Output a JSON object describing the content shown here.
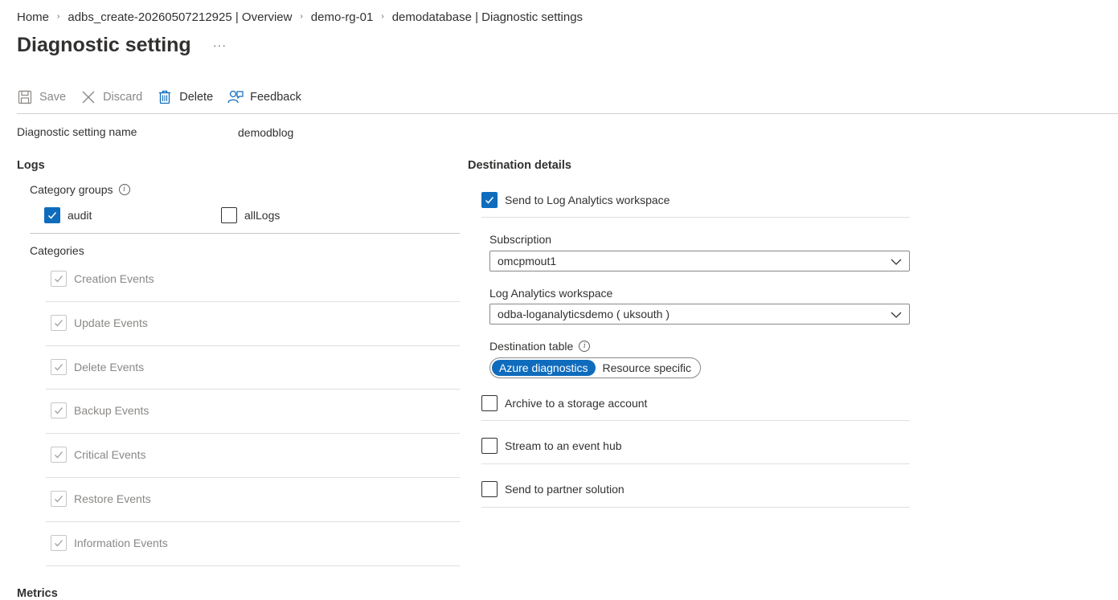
{
  "breadcrumb": {
    "items": [
      "Home",
      "adbs_create-20260507212925 | Overview",
      "demo-rg-01",
      "demodatabase | Diagnostic settings"
    ],
    "separator": "›"
  },
  "page": {
    "title": "Diagnostic setting",
    "more": "···"
  },
  "toolbar": {
    "save": "Save",
    "discard": "Discard",
    "delete": "Delete",
    "feedback": "Feedback"
  },
  "setting": {
    "name_label": "Diagnostic setting name",
    "name_value": "demodblog"
  },
  "logs": {
    "heading": "Logs",
    "category_groups_label": "Category groups",
    "info": "i",
    "groups": [
      {
        "label": "audit",
        "checked": true
      },
      {
        "label": "allLogs",
        "checked": false
      }
    ],
    "categories_label": "Categories",
    "categories": [
      {
        "label": "Creation Events",
        "checked": true,
        "disabled": true
      },
      {
        "label": "Update Events",
        "checked": true,
        "disabled": true
      },
      {
        "label": "Delete Events",
        "checked": true,
        "disabled": true
      },
      {
        "label": "Backup Events",
        "checked": true,
        "disabled": true
      },
      {
        "label": "Critical Events",
        "checked": true,
        "disabled": true
      },
      {
        "label": "Restore Events",
        "checked": true,
        "disabled": true
      },
      {
        "label": "Information Events",
        "checked": true,
        "disabled": true
      }
    ]
  },
  "metrics": {
    "heading": "Metrics"
  },
  "destination": {
    "heading": "Destination details",
    "log_analytics": {
      "label": "Send to Log Analytics workspace",
      "checked": true
    },
    "subscription_label": "Subscription",
    "subscription_value": "omcpmout1",
    "workspace_label": "Log Analytics workspace",
    "workspace_value": "odba-loganalyticsdemo ( uksouth )",
    "table_label": "Destination table",
    "info": "i",
    "table_options": [
      "Azure diagnostics",
      "Resource specific"
    ],
    "table_selected": "Azure diagnostics",
    "archive": {
      "label": "Archive to a storage account",
      "checked": false
    },
    "event_hub": {
      "label": "Stream to an event hub",
      "checked": false
    },
    "partner": {
      "label": "Send to partner solution",
      "checked": false
    }
  },
  "colors": {
    "accent": "#0f6cbd",
    "text": "#323130",
    "disabled_text": "#8a8886",
    "divider": "#e1dfdd"
  }
}
